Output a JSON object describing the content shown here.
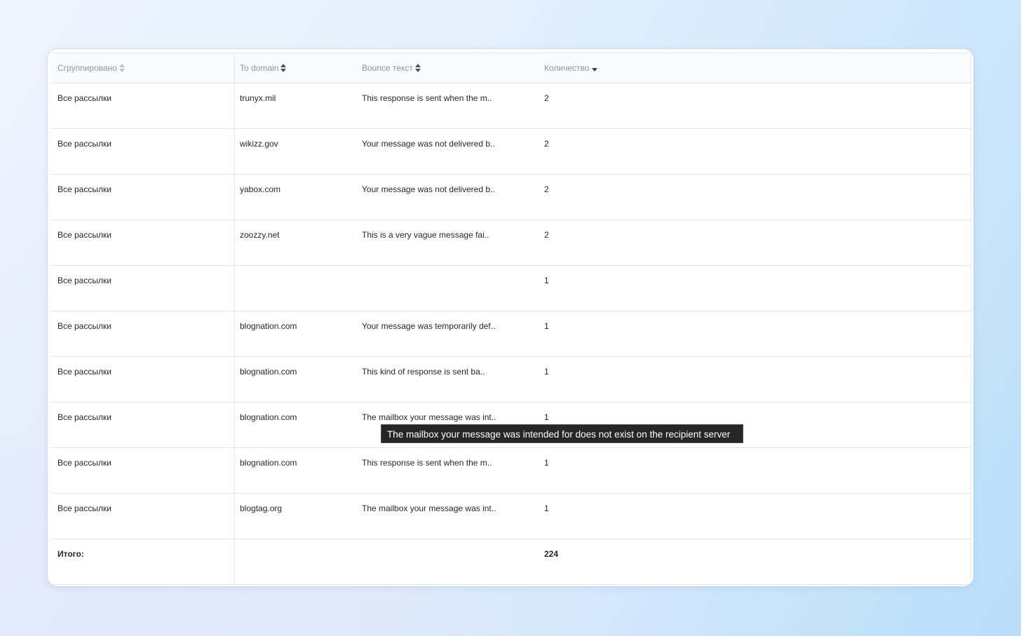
{
  "table": {
    "columns": [
      {
        "label": "Сгруппировано",
        "sort": "none"
      },
      {
        "label": "To domain",
        "sort": "both"
      },
      {
        "label": "Bounce текст",
        "sort": "both"
      },
      {
        "label": "Количество",
        "sort": "desc"
      }
    ],
    "rows": [
      {
        "group": "Все рассылки",
        "domain": "trunyx.mil",
        "bounce": "This response is sent when the m..",
        "count": "2"
      },
      {
        "group": "Все рассылки",
        "domain": "wikizz.gov",
        "bounce": "Your message was not delivered b..",
        "count": "2"
      },
      {
        "group": "Все рассылки",
        "domain": "yabox.com",
        "bounce": "Your message was not delivered b..",
        "count": "2"
      },
      {
        "group": "Все рассылки",
        "domain": "zoozzy.net",
        "bounce": "This is a very vague message fai..",
        "count": "2"
      },
      {
        "group": "Все рассылки",
        "domain": "",
        "bounce": "",
        "count": "1"
      },
      {
        "group": "Все рассылки",
        "domain": "blognation.com",
        "bounce": "Your message was temporarily def..",
        "count": "1"
      },
      {
        "group": "Все рассылки",
        "domain": "blognation.com",
        "bounce": "This kind of response is sent ba..",
        "count": "1"
      },
      {
        "group": "Все рассылки",
        "domain": "blognation.com",
        "bounce": "The mailbox your message was int..",
        "count": "1"
      },
      {
        "group": "Все рассылки",
        "domain": "blognation.com",
        "bounce": "This response is sent when the m..",
        "count": "1"
      },
      {
        "group": "Все рассылки",
        "domain": "blogtag.org",
        "bounce": "The mailbox your message was int..",
        "count": "1"
      }
    ],
    "total": {
      "label": "Итого:",
      "count": "224"
    }
  },
  "tooltip": {
    "text": "The mailbox your message was intended for does not exist on the recipient server"
  }
}
